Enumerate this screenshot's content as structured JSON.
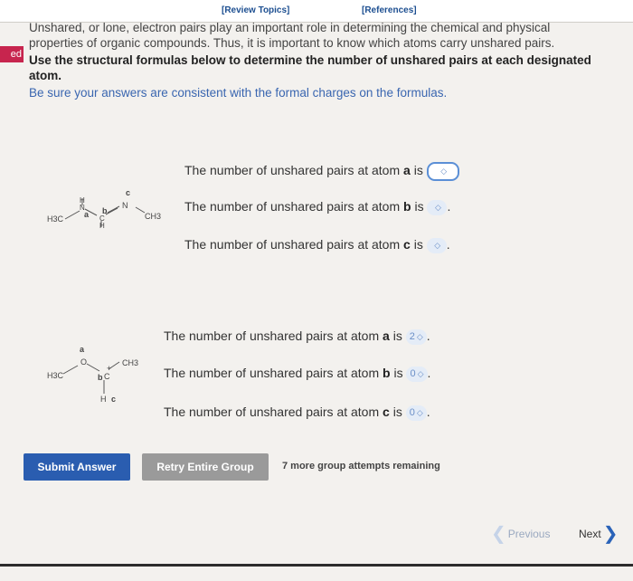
{
  "header": {
    "review_topics": "[Review Topics]",
    "references": "[References]"
  },
  "side_tab": "ed",
  "intro": {
    "line1": "Unshared, or lone, electron pairs play an important role in determining the chemical and physical properties of organic compounds. Thus, it is important to know which atoms carry unshared pairs.",
    "instruction": "Use the structural formulas below to determine the number of unshared pairs at each designated atom.",
    "note": "Be sure your answers are consistent with the formal charges on the formulas."
  },
  "molecule1": {
    "h3c": "H3C",
    "ch3": "CH3",
    "label_a": "a",
    "label_b": "b",
    "label_c": "c"
  },
  "molecule2": {
    "h3c": "H3C",
    "ch3": "CH3",
    "charge": "+",
    "label_a": "a",
    "label_b": "b",
    "label_c": "c"
  },
  "group1": [
    {
      "prefix": "The number of unshared pairs at atom ",
      "atom": "a",
      "suffix": " is",
      "value": "",
      "period": ""
    },
    {
      "prefix": "The number of unshared pairs at atom ",
      "atom": "b",
      "suffix": " is",
      "value": "",
      "period": "."
    },
    {
      "prefix": "The number of unshared pairs at atom ",
      "atom": "c",
      "suffix": " is",
      "value": "",
      "period": "."
    }
  ],
  "group2": [
    {
      "prefix": "The number of unshared pairs at atom ",
      "atom": "a",
      "suffix": " is",
      "value": "2",
      "period": "."
    },
    {
      "prefix": "The number of unshared pairs at atom ",
      "atom": "b",
      "suffix": " is",
      "value": "0",
      "period": "."
    },
    {
      "prefix": "The number of unshared pairs at atom ",
      "atom": "c",
      "suffix": " is",
      "value": "0",
      "period": "."
    }
  ],
  "buttons": {
    "submit": "Submit Answer",
    "retry": "Retry Entire Group",
    "remaining": "7 more group attempts remaining"
  },
  "nav": {
    "previous": "Previous",
    "next": "Next"
  },
  "colors": {
    "submit_bg": "#2a5db0",
    "retry_bg": "#9a9a9a",
    "link": "#1d4f91",
    "note": "#3a66b0",
    "side_tab": "#c7254e"
  }
}
